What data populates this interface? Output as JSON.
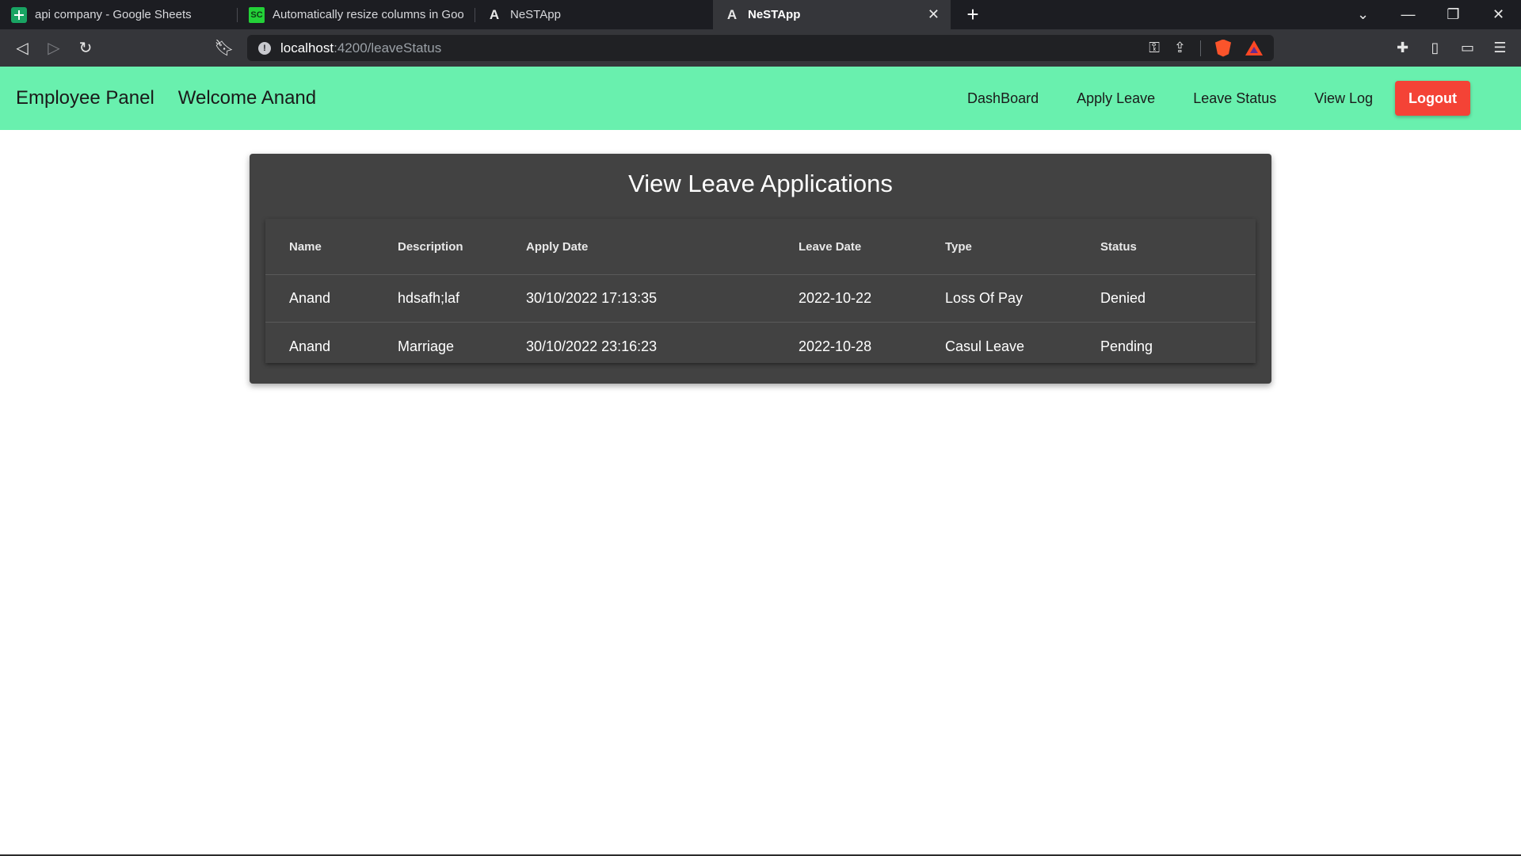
{
  "browser": {
    "tabs": [
      {
        "label": "api company - Google Sheets",
        "icon": "google-sheets-icon"
      },
      {
        "label": "Automatically resize columns in Google",
        "icon": "sc-site-icon"
      },
      {
        "label": "NeSTApp",
        "icon": "angular-icon"
      },
      {
        "label": "NeSTApp",
        "icon": "angular-icon",
        "active": true
      }
    ],
    "url_host": "localhost",
    "url_path": ":4200/leaveStatus"
  },
  "app": {
    "brand": "Employee Panel",
    "welcome": "Welcome Anand",
    "nav": [
      "DashBoard",
      "Apply Leave",
      "Leave Status",
      "View Log"
    ],
    "logout_label": "Logout",
    "accent_color": "#69f0ae",
    "logout_color": "#f44336"
  },
  "card": {
    "title": "View Leave Applications",
    "columns": [
      "Name",
      "Description",
      "Apply Date",
      "Leave Date",
      "Type",
      "Status"
    ],
    "rows": [
      [
        "Anand",
        "hdsafh;laf",
        "30/10/2022 17:13:35",
        "2022-10-22",
        "Loss Of Pay",
        "Denied"
      ],
      [
        "Anand",
        "Marriage",
        "30/10/2022 23:16:23",
        "2022-10-28",
        "Casul Leave",
        "Pending"
      ]
    ]
  }
}
